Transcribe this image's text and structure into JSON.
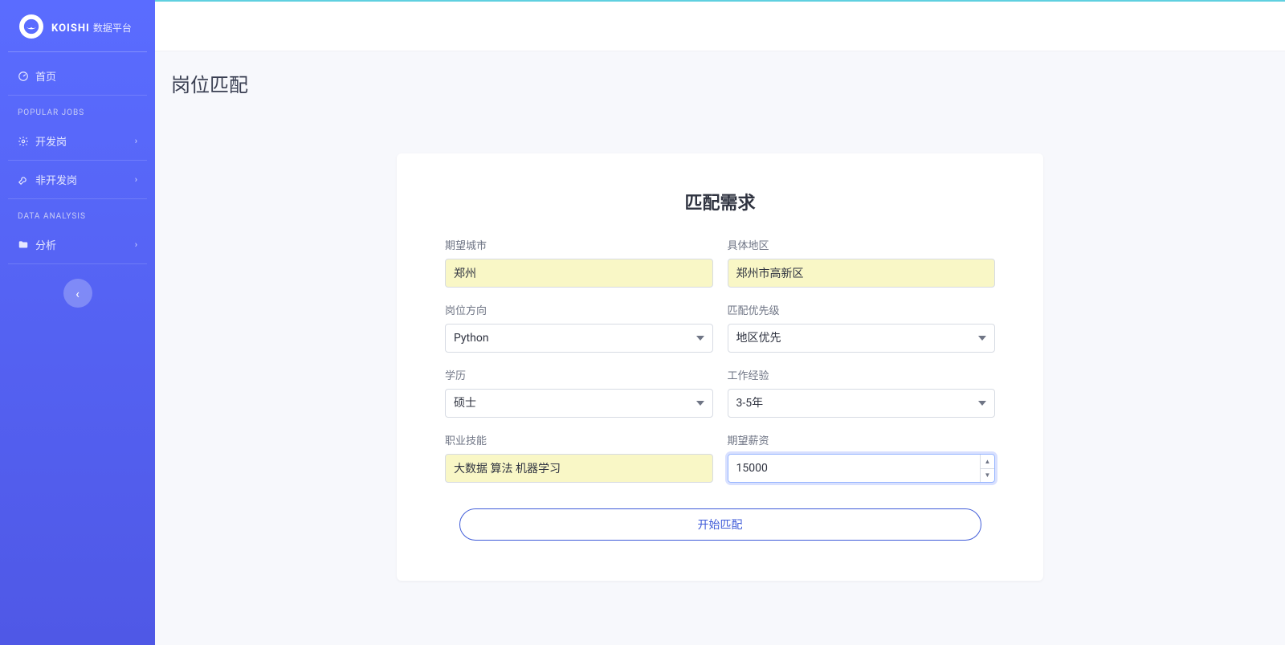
{
  "brand": {
    "name": "KOISHI",
    "sub": "数据平台"
  },
  "sidebar": {
    "home_label": "首页",
    "section1_title": "POPULAR JOBS",
    "item_dev_label": "开发岗",
    "item_nondev_label": "非开发岗",
    "section2_title": "DATA ANALYSIS",
    "item_analysis_label": "分析"
  },
  "page": {
    "title": "岗位匹配"
  },
  "form": {
    "title": "匹配需求",
    "city_label": "期望城市",
    "city_value": "郑州",
    "area_label": "具体地区",
    "area_value": "郑州市高新区",
    "direction_label": "岗位方向",
    "direction_value": "Python",
    "priority_label": "匹配优先级",
    "priority_value": "地区优先",
    "edu_label": "学历",
    "edu_value": "硕士",
    "exp_label": "工作经验",
    "exp_value": "3-5年",
    "skill_label": "职业技能",
    "skill_value": "大数据 算法 机器学习",
    "salary_label": "期望薪资",
    "salary_value": "15000",
    "submit_label": "开始匹配"
  }
}
